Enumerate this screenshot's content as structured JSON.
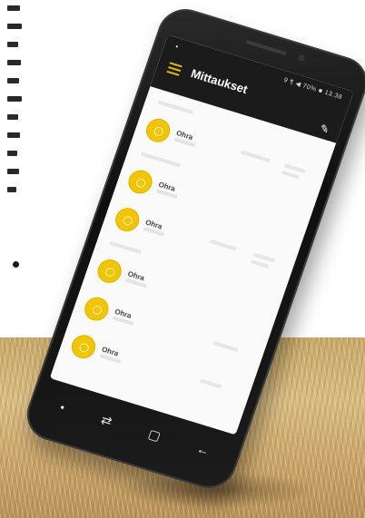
{
  "app": {
    "title": "Mittaukset",
    "status_time": "9 ¶ ◀ 70% ■ 13.38"
  },
  "sections": [
    {
      "rows": [
        {
          "title": "Ohra"
        }
      ]
    },
    {
      "rows": [
        {
          "title": "Ohra"
        },
        {
          "title": "Ohra"
        }
      ]
    },
    {
      "rows": [
        {
          "title": "Ohra"
        },
        {
          "title": "Ohra"
        },
        {
          "title": "Ohra"
        }
      ]
    }
  ],
  "icons": {
    "menu": "menu-icon",
    "edit": "pencil-icon",
    "nav_back": "back-arrow-icon",
    "nav_home": "square-home-icon",
    "nav_recent": "recent-apps-icon"
  },
  "colors": {
    "accent": "#f3c400",
    "app_bar": "#1b1b1b",
    "menu_accent": "#e8b800"
  }
}
